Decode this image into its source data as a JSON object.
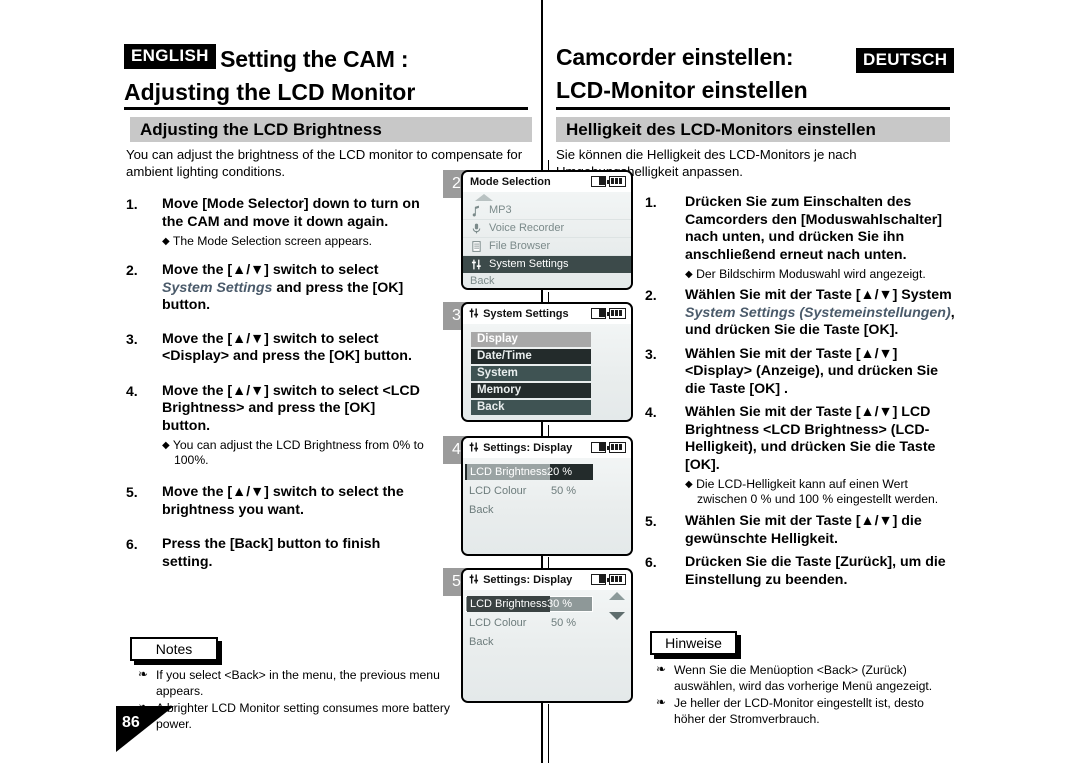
{
  "header": {
    "english": {
      "chip": "ENGLISH",
      "title_line1": "Setting the CAM :",
      "title_line2": "Adjusting the LCD Monitor",
      "section_bar": "Adjusting the LCD Brightness"
    },
    "german": {
      "chip": "DEUTSCH",
      "title_line1": "Camcorder einstellen:",
      "title_line2": "LCD-Monitor einstellen",
      "section_bar": "Helligkeit des LCD-Monitors einstellen"
    }
  },
  "english": {
    "intro": "You can adjust the brightness of the LCD monitor to compensate for ambient lighting conditions.",
    "steps": [
      {
        "num": "1.",
        "text": "Move [Mode Selector] down to turn on the CAM and move it down again.",
        "sub": "The Mode Selection screen appears."
      },
      {
        "num": "2.",
        "text_before": "Move the [▲/▼] switch to select ",
        "italic": "System Settings",
        "text_after": " and press the [OK] button.",
        "sub": ""
      },
      {
        "num": "3.",
        "text": "Move the [▲/▼] switch to select <Display> and press the [OK] button.",
        "sub": ""
      },
      {
        "num": "4.",
        "text": "Move the [▲/▼] switch to select <LCD Brightness> and press the [OK] button.",
        "sub": "You can adjust the LCD Brightness from 0% to 100%."
      },
      {
        "num": "5.",
        "text": "Move the [▲/▼] switch to select the brightness you want.",
        "sub": ""
      },
      {
        "num": "6.",
        "text": "Press the [Back] button to finish setting.",
        "sub": ""
      }
    ],
    "notes_label": "Notes",
    "notes": [
      "If you select <Back> in the menu, the previous menu appears.",
      "A brighter LCD Monitor setting consumes more battery power."
    ]
  },
  "german": {
    "intro": "Sie können die Helligkeit des LCD-Monitors je nach Umgebungshelligkeit anpassen.",
    "steps": [
      {
        "num": "1.",
        "text": "Drücken Sie zum Einschalten des Camcorders den [Moduswahlschalter] nach unten, und drücken Sie ihn anschließend erneut nach unten.",
        "sub": "Der Bildschirm Moduswahl wird angezeigt."
      },
      {
        "num": "2.",
        "text_before": "Wählen Sie mit der Taste [▲/▼] System ",
        "italic": "System Settings (Systemeinstellungen)",
        "text_after": ", und drücken Sie die Taste [OK].",
        "sub": ""
      },
      {
        "num": "3.",
        "text": "Wählen Sie mit der Taste [▲/▼] <Display> (Anzeige), und drücken Sie die Taste [OK] .",
        "sub": ""
      },
      {
        "num": "4.",
        "text": "Wählen Sie mit der Taste [▲/▼] LCD Brightness <LCD Brightness> (LCD-Helligkeit), und drücken Sie die Taste [OK].",
        "sub": "Die LCD-Helligkeit kann auf einen Wert zwischen 0 % und 100 % eingestellt werden."
      },
      {
        "num": "5.",
        "text": "Wählen Sie mit der Taste [▲/▼] die gewünschte Helligkeit.",
        "sub": ""
      },
      {
        "num": "6.",
        "text": "Drücken Sie die Taste [Zurück], um die Einstellung zu beenden.",
        "sub": ""
      }
    ],
    "notes_label": "Hinweise",
    "notes": [
      "Wenn Sie die Menüoption <Back> (Zurück) auswählen, wird das vorherige Menü angezeigt.",
      "Je heller der LCD-Monitor eingestellt ist, desto höher der Stromverbrauch."
    ]
  },
  "screens": [
    {
      "badge": "2",
      "title": "Mode Selection",
      "icons": [
        "memory-card-icon",
        "battery-icon"
      ],
      "items": [
        {
          "label": "MP3",
          "icon": "music-note-icon",
          "state": "normal"
        },
        {
          "label": "Voice Recorder",
          "icon": "microphone-icon",
          "state": "normal"
        },
        {
          "label": "File Browser",
          "icon": "document-icon",
          "state": "normal"
        },
        {
          "label": "System Settings",
          "icon": "sliders-icon",
          "state": "selected"
        },
        {
          "label": "Back",
          "icon": "",
          "state": "plain"
        }
      ]
    },
    {
      "badge": "3",
      "title": "System Settings",
      "title_icon": "sliders-icon",
      "icons": [
        "memory-card-icon",
        "battery-icon"
      ],
      "items": [
        {
          "label": "Display",
          "state": "highlight"
        },
        {
          "label": "Date/Time",
          "state": "dark"
        },
        {
          "label": "System",
          "state": "teal"
        },
        {
          "label": "Memory",
          "state": "dark"
        },
        {
          "label": "Back",
          "state": "teal"
        }
      ]
    },
    {
      "badge": "4",
      "title": "Settings: Display",
      "title_icon": "sliders-icon",
      "icons": [
        "memory-card-icon",
        "battery-icon"
      ],
      "rows": [
        {
          "label": "LCD Brightness",
          "value": "20 %",
          "state": "selected-dark"
        },
        {
          "label": "LCD Colour",
          "value": "50 %",
          "state": "normal"
        },
        {
          "label": "Back",
          "value": "",
          "state": "normal"
        }
      ],
      "scroll": false
    },
    {
      "badge": "5",
      "title": "Settings: Display",
      "title_icon": "sliders-icon",
      "icons": [
        "memory-card-icon",
        "battery-icon"
      ],
      "rows": [
        {
          "label": "LCD Brightness",
          "value": "30 %",
          "state": "selected-gray"
        },
        {
          "label": "LCD Colour",
          "value": "50 %",
          "state": "normal"
        },
        {
          "label": "Back",
          "value": "",
          "state": "normal"
        }
      ],
      "scroll": true
    }
  ],
  "page_number": "86",
  "colors": {
    "section_bar": "#c8c8c8",
    "badge": "#9b9b9b",
    "lcd_selected": "#3c4a4a",
    "italic_text": "#4a5a6a"
  }
}
